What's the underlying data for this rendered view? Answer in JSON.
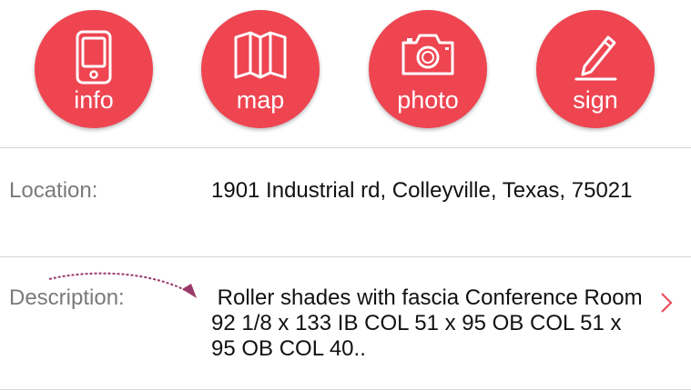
{
  "actions": [
    {
      "label": "info",
      "icon": "phone-icon"
    },
    {
      "label": "map",
      "icon": "map-icon"
    },
    {
      "label": "photo",
      "icon": "camera-icon"
    },
    {
      "label": "sign",
      "icon": "pencil-icon"
    }
  ],
  "location": {
    "label": "Location:",
    "value": "1901 Industrial rd, Colleyville, Texas, 75021"
  },
  "description": {
    "label": "Description:",
    "value": " Roller shades with fascia Conference Room 92 1/8 x 133 IB COL 51 x 95 OB COL 51 x 95 OB COL 40.."
  },
  "colors": {
    "accent": "#ee4551",
    "label_text": "#7a7a7a",
    "value_text": "#111111",
    "divider": "#d9d9d9",
    "annotation_arrow": "#9a3a6a"
  }
}
